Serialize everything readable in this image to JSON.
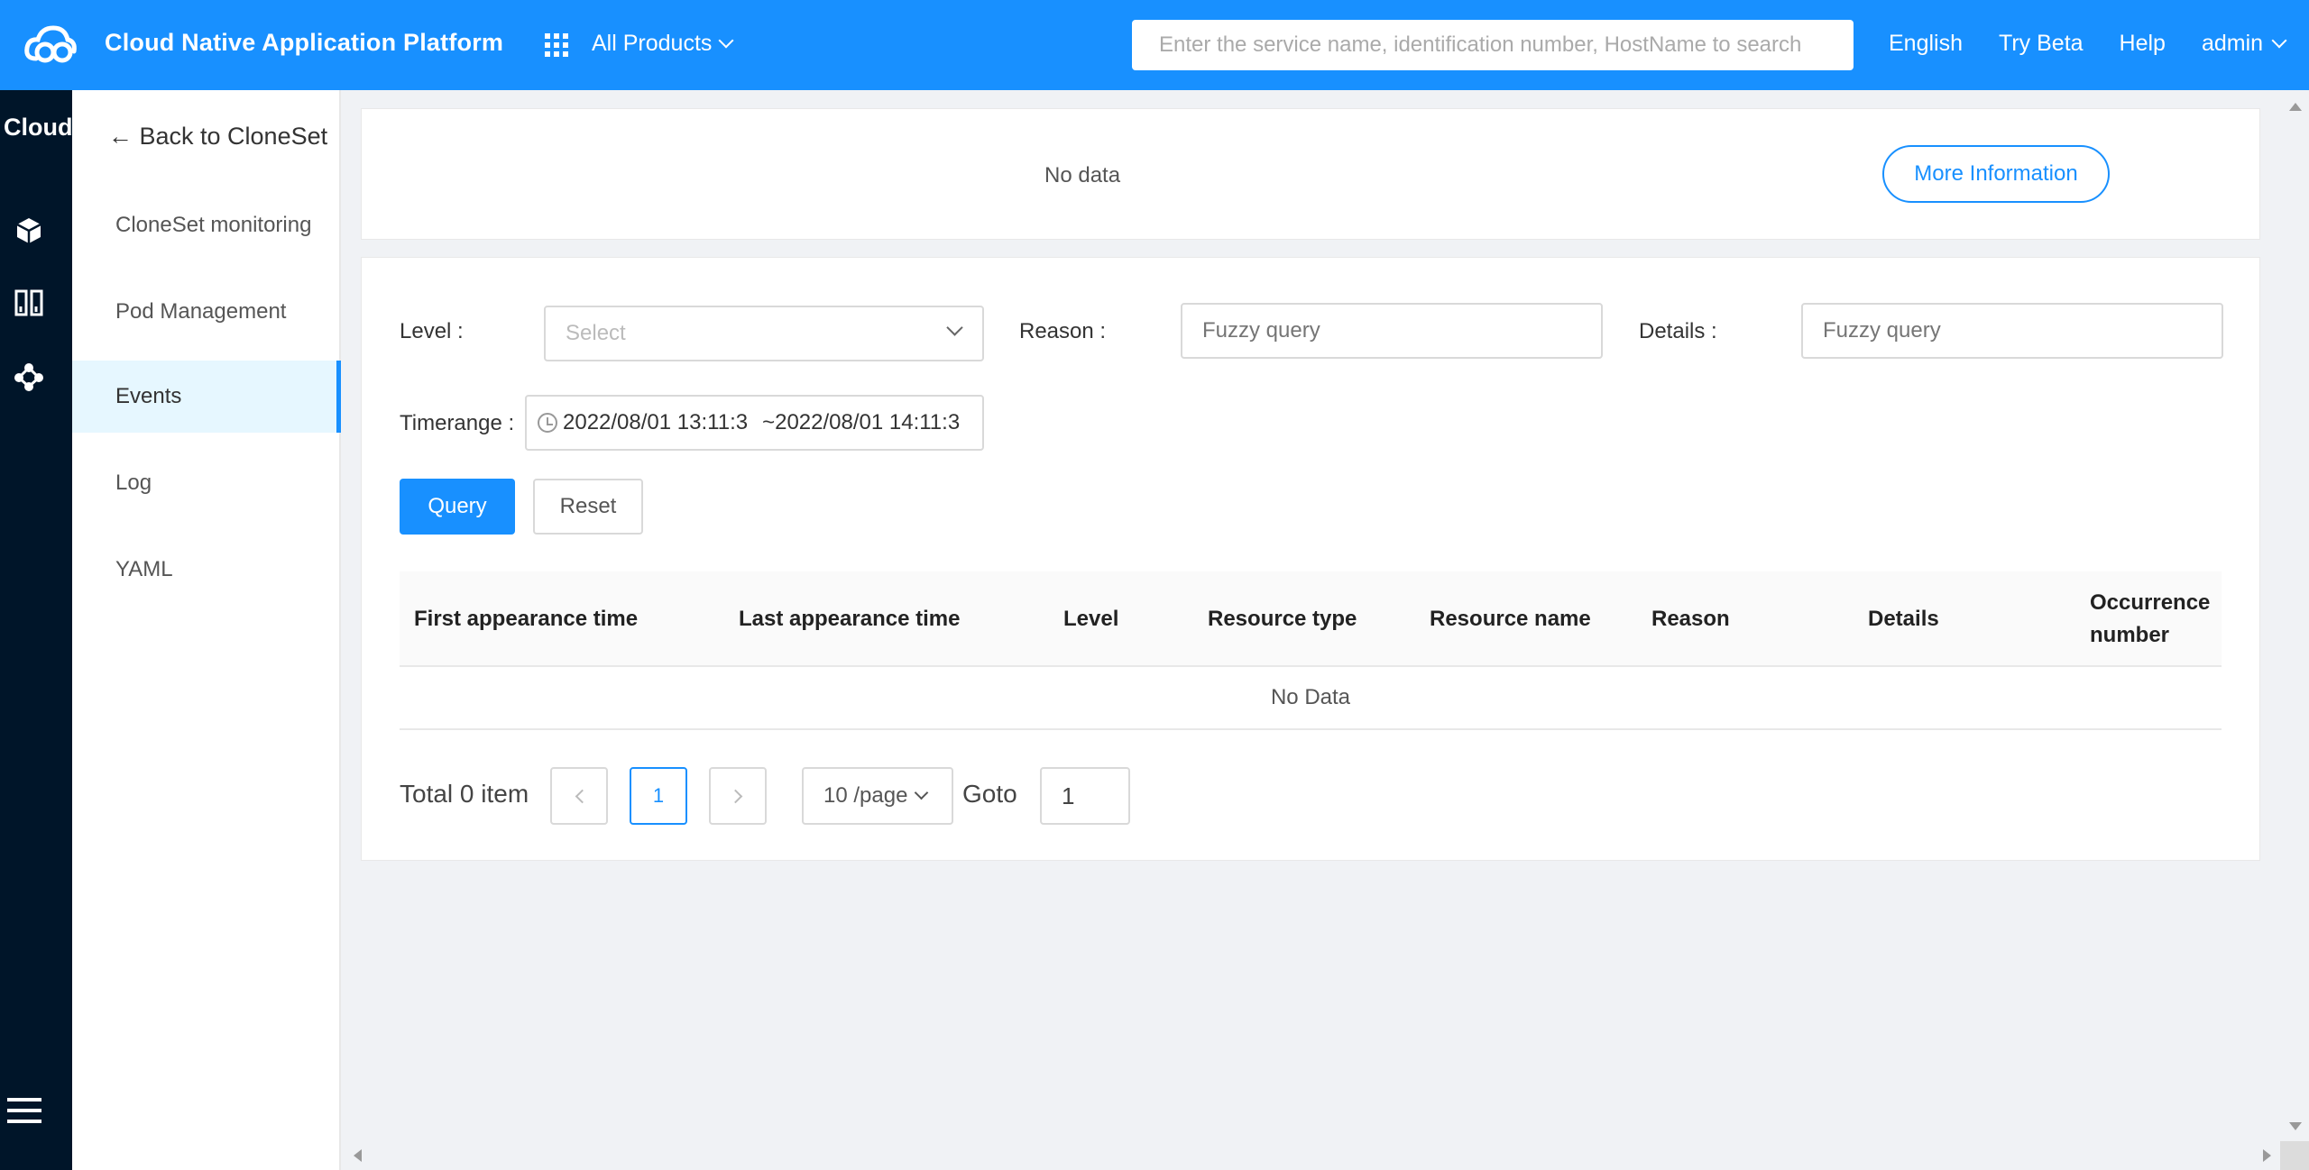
{
  "header": {
    "brand": "Cloud Native Application Platform",
    "all_products": "All Products",
    "search_placeholder": "Enter the service name, identification number, HostName to search",
    "links": {
      "language": "English",
      "beta": "Try Beta",
      "help": "Help",
      "user": "admin"
    },
    "accent": "#1890ff"
  },
  "rail": {
    "title": "Cloud",
    "icons": [
      "cube-icon",
      "columns-icon",
      "cluster-icon",
      "menu-icon"
    ]
  },
  "subnav": {
    "back": "← Back to CloneSet",
    "items": [
      {
        "label": "CloneSet monitoring",
        "active": false
      },
      {
        "label": "Pod Management",
        "active": false
      },
      {
        "label": "Events",
        "active": true
      },
      {
        "label": "Log",
        "active": false
      },
      {
        "label": "YAML",
        "active": false
      }
    ]
  },
  "info_card": {
    "no_data": "No data",
    "more_button": "More Information"
  },
  "filters": {
    "level_label": "Level :",
    "level_placeholder": "Select",
    "reason_label": "Reason :",
    "reason_placeholder": "Fuzzy query",
    "details_label": "Details :",
    "details_placeholder": "Fuzzy query",
    "timerange_label": "Timerange :",
    "time_start": "2022/08/01 13:11:3",
    "time_end": "~2022/08/01 14:11:3",
    "query_button": "Query",
    "reset_button": "Reset"
  },
  "table": {
    "columns": [
      "First appearance time",
      "Last appearance time",
      "Level",
      "Resource type",
      "Resource name",
      "Reason",
      "Details",
      "Occurrence number"
    ],
    "empty_text": "No Data"
  },
  "pagination": {
    "total": "Total 0 item",
    "current_page": "1",
    "page_size": "10 /page",
    "goto_label": "Goto",
    "goto_value": "1"
  }
}
